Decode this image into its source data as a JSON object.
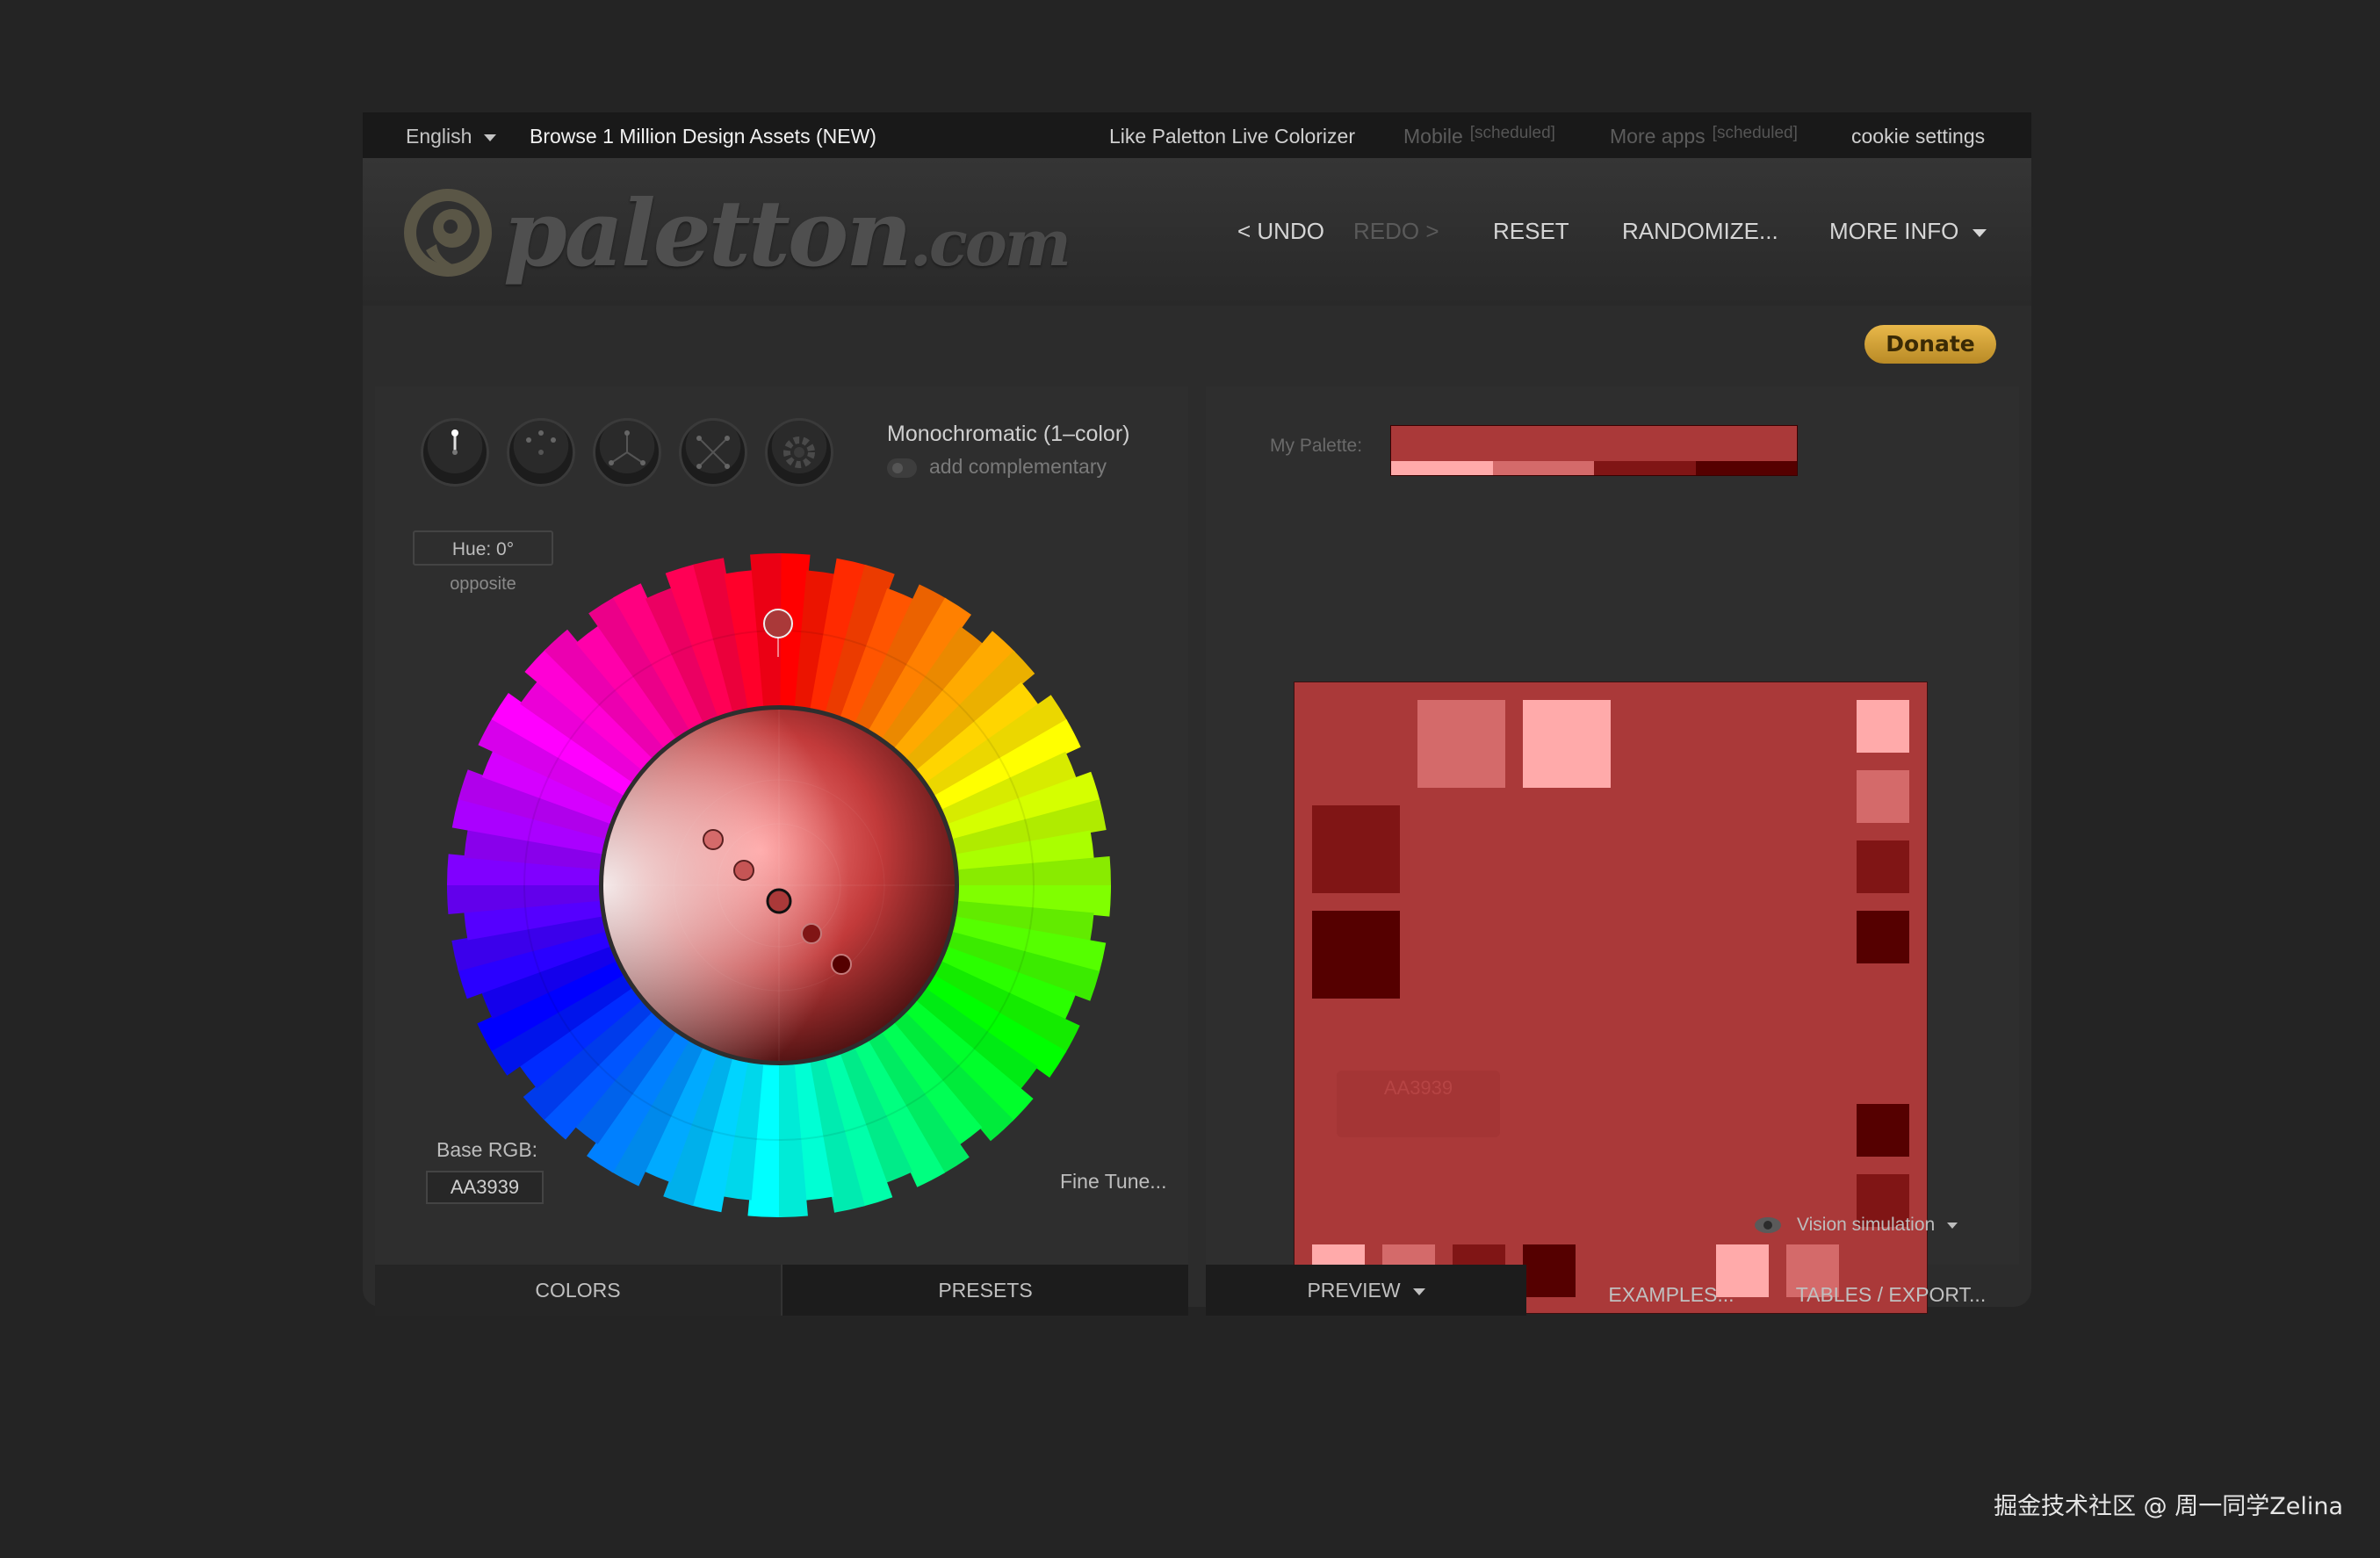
{
  "topbar": {
    "language": "English",
    "browse": "Browse 1 Million Design Assets (NEW)",
    "like": "Like Paletton Live Colorizer",
    "mobile": "Mobile",
    "mobile_tag": "[scheduled]",
    "more_apps": "More apps",
    "more_apps_tag": "[scheduled]",
    "cookie": "cookie settings"
  },
  "header": {
    "logo_text": "paletton",
    "logo_suffix": ".com",
    "undo": "< UNDO",
    "redo": "REDO >",
    "reset": "RESET",
    "randomize": "RANDOMIZE...",
    "more_info": "MORE INFO"
  },
  "donate": "Donate",
  "left": {
    "scheme": "Monochromatic (1–color)",
    "add_complementary": "add complementary",
    "hue": "Hue: 0°",
    "opposite": "opposite",
    "base_rgb_label": "Base RGB:",
    "base_rgb_value": "AA3939",
    "fine_tune": "Fine Tune...",
    "tab_colors": "COLORS",
    "tab_presets": "PRESETS"
  },
  "right": {
    "my_palette_label": "My Palette:",
    "ghost_button": "AA3939",
    "vision": "Vision simulation",
    "tab_preview": "PREVIEW",
    "tab_examples": "EXAMPLES...",
    "tab_tables": "TABLES / EXPORT..."
  },
  "colors": {
    "base": "#AA3939",
    "lightest": "#FFAAAA",
    "light": "#D46A6A",
    "dark": "#801515",
    "darkest": "#550000",
    "donate_gold": "#D9A93C",
    "page_bg": "#242424"
  },
  "watermark": "掘金技术社区 @ 周一同学Zelina"
}
